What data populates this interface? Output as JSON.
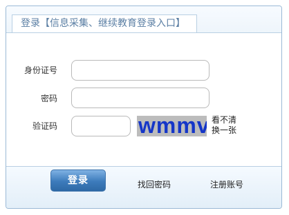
{
  "header": {
    "title": "登录【信息采集、继续教育登录入口】"
  },
  "form": {
    "id_label": "身份证号",
    "id_value": "",
    "password_label": "密码",
    "password_value": "",
    "captcha_label": "验证码",
    "captcha_value": "",
    "captcha_image_text": "wmmv",
    "refresh_line1": "看不清",
    "refresh_line2": "换一张"
  },
  "footer": {
    "login_label": "登录",
    "forgot_password_label": "找回密码",
    "register_label": "注册账号"
  },
  "colors": {
    "accent": "#3c7bbb",
    "border": "#9ab9d6",
    "captcha_text": "#1536c8",
    "captcha_bg": "#bcbcbc"
  }
}
